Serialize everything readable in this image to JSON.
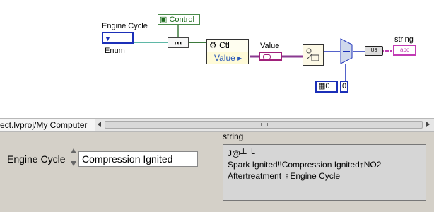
{
  "block_diagram": {
    "enum_caption": "Engine Cycle",
    "enum_text": "Enum",
    "control_ref_text": "Control",
    "property_node": {
      "class_label": "Ctl",
      "property": "Value"
    },
    "variant_caption": "Value",
    "numeric_constant": "0",
    "numeric_indicator": "0",
    "string_caption": "string",
    "string_icon_text": "abc",
    "u8_text": "U8",
    "wire_colors": {
      "enum": "#2aa08a",
      "refnum": "#3d7a3d",
      "variant": "#8a3a90",
      "numeric": "#1b2fb8",
      "string": "#c23bb4"
    }
  },
  "tab": {
    "path": "ect.lvproj/My Computer"
  },
  "front_panel": {
    "engine_cycle_label": "Engine Cycle",
    "engine_cycle_value": "Compression Ignited",
    "string_label": "string",
    "string_lines": [
      "J@┴ └",
      "Spark Ignited‼Compression Ignited↑NO2",
      "Aftertreatment ♀Engine Cycle"
    ]
  }
}
